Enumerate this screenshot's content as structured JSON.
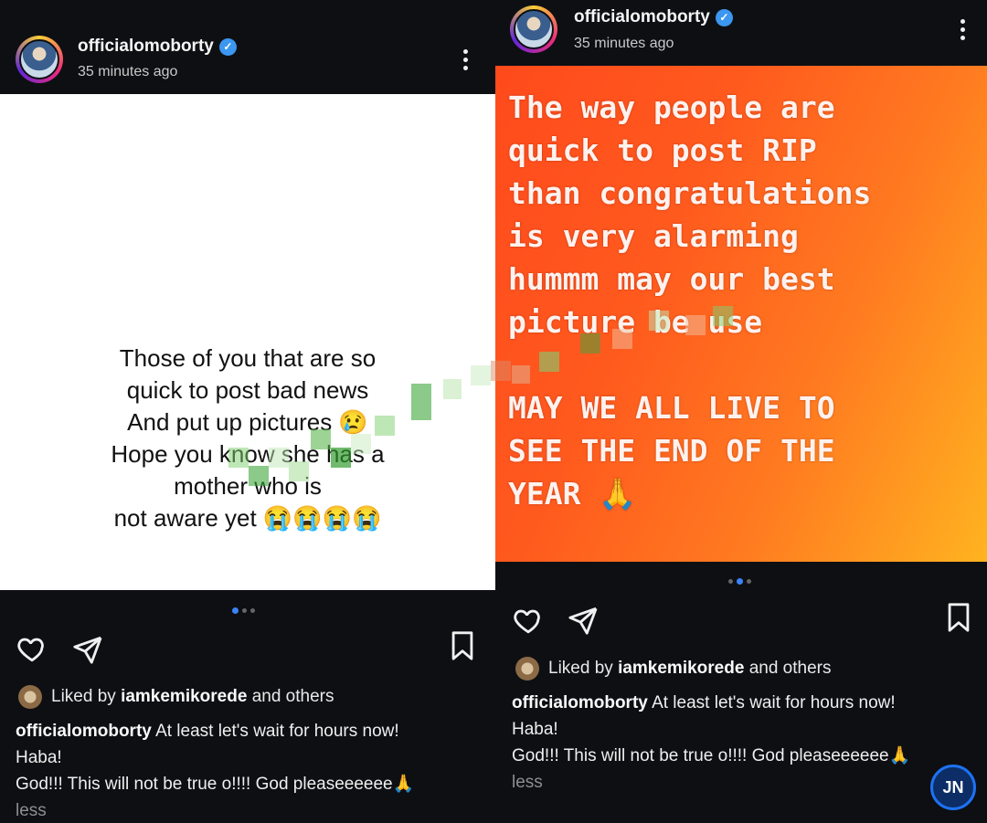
{
  "left_post": {
    "username": "officialomoborty",
    "time": "35 minutes ago",
    "content_lines": [
      "Those of you that are so",
      "quick to post bad news",
      "And put up pictures 😢",
      "Hope you know she has a",
      "mother who is",
      "not aware yet 😭😭😭😭"
    ],
    "liked_by_prefix": "Liked by",
    "liked_by_user": "iamkemikorede",
    "liked_by_suffix": "and others",
    "caption_user": "officialomoborty",
    "caption_text": "At least let's wait for hours now!",
    "caption_line2": "Haba!",
    "caption_line3": "God!!! This will not be true o!!!! God pleaseeeeee🙏",
    "less_label": "less"
  },
  "right_post": {
    "username": "officialomoborty",
    "time": "35 minutes ago",
    "content_text": "The way people are\nquick to post RIP\nthan congratulations\nis very alarming\nhummm may our best\npicture      be use\n\nMAY WE ALL LIVE TO\nSEE THE END OF THE\nYEAR 🙏",
    "liked_by_prefix": "Liked by",
    "liked_by_user": "iamkemikorede",
    "liked_by_suffix": "and others",
    "caption_user": "officialomoborty",
    "caption_text": "At least let's wait for hours now!",
    "caption_line2": "Haba!",
    "caption_line3": "God!!! This will not be true o!!!! God pleaseeeeee🙏",
    "less_label": "less"
  },
  "watermark_logo": "JN",
  "colors": {
    "background": "#0e0f13",
    "verified": "#3b97f0",
    "carousel_active": "#3b82f6",
    "gradient_start": "#ff4a1c",
    "gradient_end": "#ffb320"
  },
  "icons": [
    "heart-icon",
    "share-icon",
    "bookmark-icon",
    "more-options-icon",
    "verified-badge-icon"
  ]
}
